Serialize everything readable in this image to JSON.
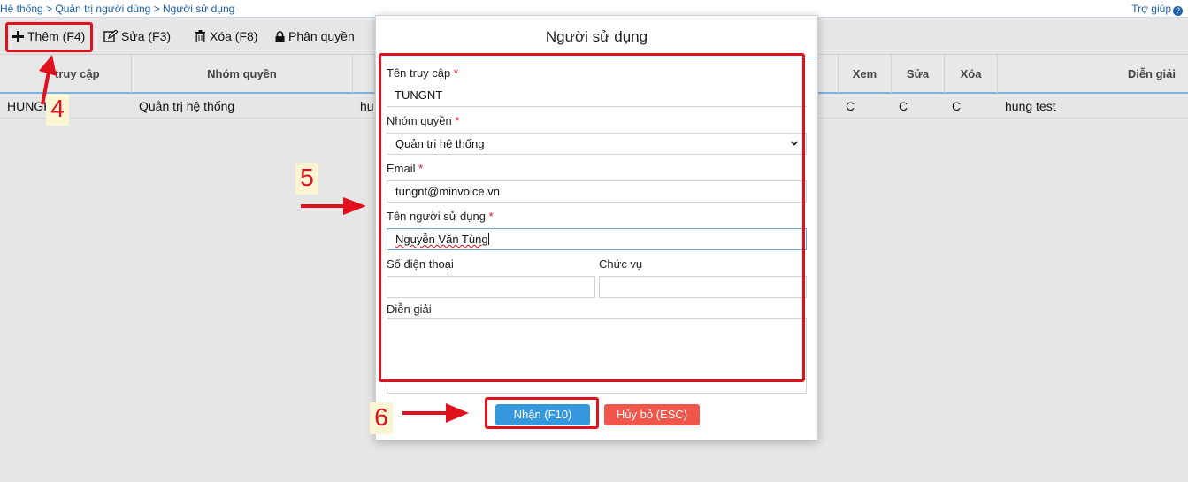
{
  "breadcrumb": "Hệ thống > Quản trị người dùng > Người sử dụng",
  "help_label": "Trợ giúp",
  "toolbar": {
    "add": "Thêm (F4)",
    "edit": "Sửa (F3)",
    "delete": "Xóa (F8)",
    "permission": "Phân quyền"
  },
  "grid": {
    "headers": [
      "truy cập",
      "Nhóm quyền",
      "Xem",
      "Sửa",
      "Xóa",
      "Diễn giải"
    ],
    "row": [
      "HUNGK",
      "Quản trị hệ thống",
      "hu",
      "C",
      "C",
      "C",
      "hung test"
    ]
  },
  "dialog": {
    "title": "Người sử dụng",
    "username_label": "Tên truy cập",
    "username_value": "TUNGNT",
    "group_label": "Nhóm quyền",
    "group_value": "Quản trị hệ thống",
    "email_label": "Email",
    "email_value": "tungnt@minvoice.vn",
    "fullname_label": "Tên người sử dụng",
    "fullname_value": "Nguyễn Văn Tùng",
    "phone_label": "Số điện thoại",
    "phone_value": "",
    "position_label": "Chức vụ",
    "position_value": "",
    "note_label": "Diễn giải",
    "note_value": "",
    "required_mark": "*",
    "ok_label": "Nhận (F10)",
    "cancel_label": "Hủy bỏ (ESC)"
  },
  "annotations": [
    "4",
    "5",
    "6"
  ],
  "colors": {
    "annotation_red": "#e0101d",
    "ok_button": "#3598dc",
    "cancel_button": "#f0574a",
    "annotation_label_bg": "#fbf5d4"
  }
}
